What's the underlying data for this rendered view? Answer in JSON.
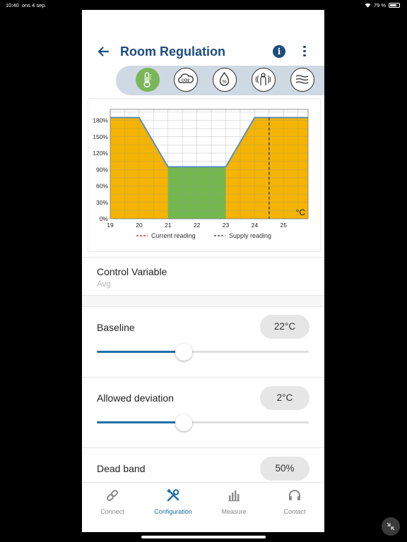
{
  "status_bar": {
    "time": "10:40",
    "date": "ons 4 sep.",
    "battery": "79 %",
    "battery_level": 0.79
  },
  "header": {
    "title": "Room Regulation",
    "info_icon": "i"
  },
  "tabs": [
    {
      "icon": "thermometer-icon",
      "active": true
    },
    {
      "icon": "co2-icon",
      "active": false,
      "text": "CO2"
    },
    {
      "icon": "humidity-icon",
      "active": false,
      "text": "%"
    },
    {
      "icon": "occupancy-icon",
      "active": false
    },
    {
      "icon": "airflow-icon",
      "active": false
    }
  ],
  "chart_data": {
    "type": "area",
    "x_ticks": [
      "19",
      "20",
      "21",
      "22",
      "23",
      "24",
      "25"
    ],
    "y_ticks": [
      "0%",
      "30%",
      "60%",
      "90%",
      "120%",
      "150%",
      "180%"
    ],
    "xlim": [
      19,
      25.85
    ],
    "ylim": [
      0,
      200
    ],
    "unit_label": "°C",
    "curve": {
      "x": [
        19,
        20,
        21,
        23,
        24,
        25.85
      ],
      "y": [
        185,
        185,
        95,
        95,
        185,
        185
      ]
    },
    "dead_band": {
      "x_start": 21,
      "x_end": 23,
      "y": 95
    },
    "supply_reading_x": 24.5,
    "legend": [
      {
        "label": "Current reading",
        "color": "#d0312d"
      },
      {
        "label": "Supply reading",
        "color": "#555555"
      }
    ],
    "colors": {
      "heating_cooling": "#f5b400",
      "dead_band": "#72b84f",
      "curve": "#5b8fbf",
      "grid": "#9a9a9a"
    }
  },
  "control_variable": {
    "label": "Control Variable",
    "value": "Avg"
  },
  "baseline": {
    "label": "Baseline",
    "value": "22°C",
    "slider_fraction": 0.41
  },
  "allowed_deviation": {
    "label": "Allowed deviation",
    "value": "2°C",
    "slider_fraction": 0.41
  },
  "dead_band": {
    "label": "Dead band",
    "value": "50%"
  },
  "bottom_nav": [
    {
      "label": "Connect",
      "icon": "link-icon",
      "active": false
    },
    {
      "label": "Configuration",
      "icon": "tools-icon",
      "active": true
    },
    {
      "label": "Measure",
      "icon": "bar-chart-icon",
      "active": false
    },
    {
      "label": "Contact",
      "icon": "headset-icon",
      "active": false
    }
  ],
  "colors": {
    "primary": "#1c4c7c",
    "accent": "#1f6fa8",
    "active_tab": "#7ab65a"
  }
}
